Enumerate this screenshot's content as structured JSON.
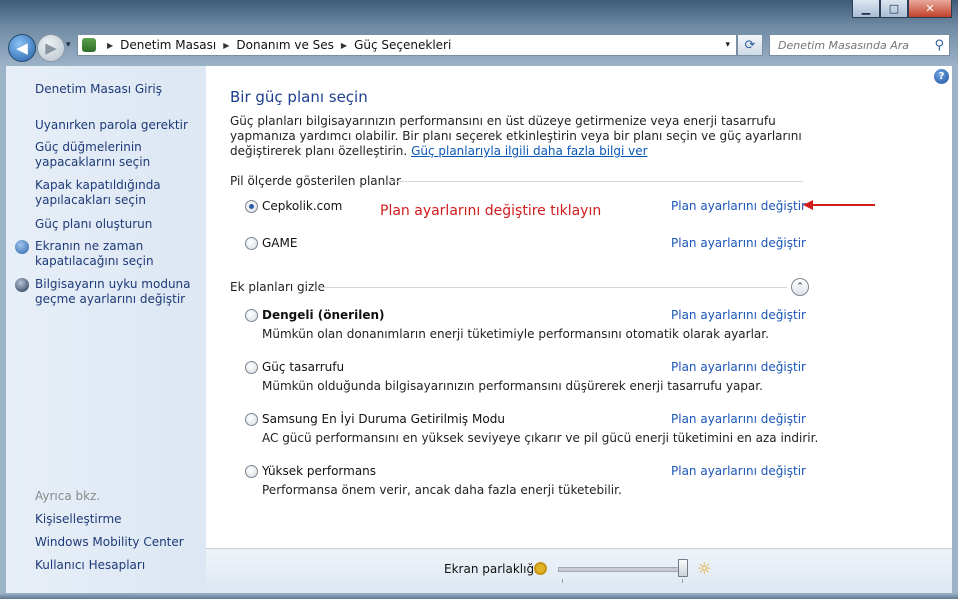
{
  "window": {
    "minimize": "▁",
    "maximize": "□",
    "close": "✕"
  },
  "nav": {
    "back_icon": "◀",
    "forward_icon": "▶",
    "dropdown_icon": "▾"
  },
  "address": {
    "crumbs": [
      "Denetim Masası",
      "Donanım ve Ses",
      "Güç Seçenekleri"
    ],
    "separator": "▶",
    "dropdown": "▾",
    "refresh_icon": "⟳"
  },
  "search": {
    "placeholder": "Denetim Masasında Ara",
    "icon": "⚲"
  },
  "sidebar": {
    "home": "Denetim Masası Giriş",
    "links": [
      "Uyanırken parola gerektir",
      "Güç düğmelerinin yapacaklarını seçin",
      "Kapak kapatıldığında yapılacakları seçin",
      "Güç planı oluşturun",
      "Ekranın ne zaman kapatılacağını seçin",
      "Bilgisayarın uyku moduna geçme ayarlarını değiştir"
    ],
    "see_also_heading": "Ayrıca bkz.",
    "see_also": [
      "Kişiselleştirme",
      "Windows Mobility Center",
      "Kullanıcı Hesapları"
    ]
  },
  "main": {
    "help_icon": "?",
    "title": "Bir güç planı seçin",
    "intro_text": "Güç planları bilgisayarınızın performansını en üst düzeye getirmenize veya enerji tasarrufu yapmanıza yardımcı olabilir. Bir planı seçerek etkinleştirin veya bir planı seçin ve güç ayarlarını değiştirerek planı özelleştirin.",
    "intro_link": "Güç planlarıyla ilgili daha fazla bilgi ver",
    "battery_group": "Pil ölçerde gösterilen planlar",
    "hidden_group": "Ek planları gizle",
    "collapse_icon": "⌃",
    "change_link": "Plan ayarlarını değiştir",
    "annotation": "Plan ayarlarını değiştire tıklayın",
    "battery_plans": [
      {
        "name": "Cepkolik.com",
        "selected": true
      },
      {
        "name": "GAME",
        "selected": false
      }
    ],
    "extra_plans": [
      {
        "name": "Dengeli (önerilen)",
        "desc": "Mümkün olan donanımların enerji tüketimiyle performansını otomatik olarak ayarlar.",
        "bold": true
      },
      {
        "name": "Güç tasarrufu",
        "desc": "Mümkün olduğunda bilgisayarınızın performansını düşürerek enerji tasarrufu yapar.",
        "bold": false
      },
      {
        "name": "Samsung En İyi Duruma Getirilmiş Modu",
        "desc": "AC gücü performansını en yüksek seviyeye çıkarır ve pil gücü enerji tüketimini en aza indirir.",
        "bold": false
      },
      {
        "name": "Yüksek performans",
        "desc": "Performansa önem verir, ancak daha fazla enerji tüketebilir.",
        "bold": false
      }
    ]
  },
  "brightness": {
    "label": "Ekran parlaklığı:",
    "level": 1.0,
    "sun_icon": "☼"
  },
  "colors": {
    "link": "#1a56b8",
    "title": "#1e3f8f",
    "annotation": "#d11c1c"
  }
}
